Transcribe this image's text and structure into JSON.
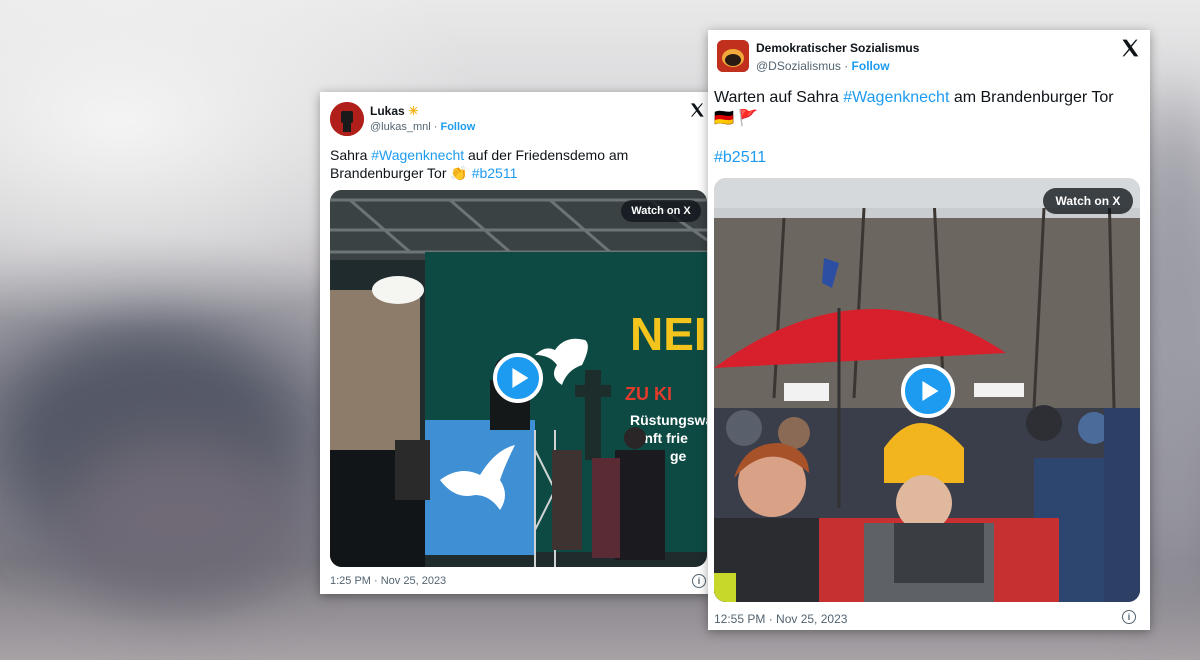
{
  "tweet1": {
    "name": "Lukas",
    "name_emoji": "☀",
    "handle": "@lukas_mnl",
    "follow_label": "Follow",
    "text_parts": [
      "Sahra ",
      "#Wagenknecht",
      " auf der Friedensdemo am Brandenburger Tor ",
      "👏",
      " ",
      "#b2511"
    ],
    "watch_label": "Watch on X",
    "timestamp": "1:25 PM · Nov 25, 2023",
    "video_signs": [
      "NEIN",
      "ZU KI",
      "Rüstungswa",
      "kunft frie",
      "ge"
    ]
  },
  "tweet2": {
    "name": "Demokratischer Sozialismus",
    "handle": "@DSozialismus",
    "handle_separator": " · ",
    "follow_label": "Follow",
    "text_line1_parts": [
      "Warten auf Sahra ",
      "#Wagenknecht",
      " am Brandenburger Tor"
    ],
    "flags": [
      "🇩🇪",
      "🚩"
    ],
    "hashtag": "#b2511",
    "watch_label": "Watch on X",
    "timestamp": "12:55 PM · Nov 25, 2023"
  },
  "icons": {
    "x_logo": "x-logo-icon",
    "play": "play-icon",
    "info": "info-icon"
  },
  "colors": {
    "link": "#1d9bf0",
    "stage_green": "#0e4a44",
    "umbrella_red": "#d8202c",
    "hat_yellow": "#f2b51e"
  }
}
